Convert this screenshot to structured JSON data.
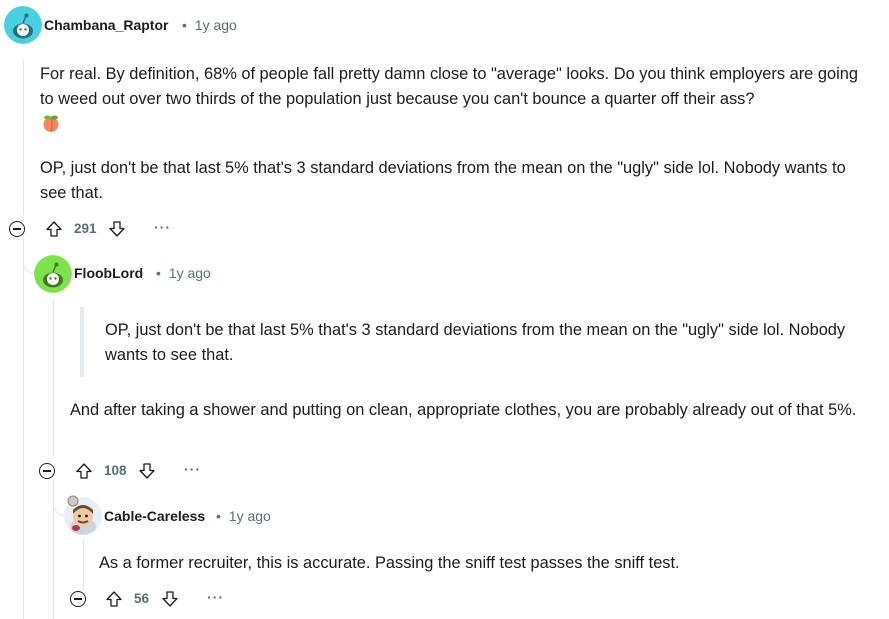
{
  "comments": [
    {
      "username": "Chambana_Raptor",
      "separator": "•",
      "time": "1y ago",
      "paragraphs": [
        "For real. By definition, 68% of people fall pretty damn close to \"average\" looks. Do you think employers are going to weed out over two thirds of the population just because you can't bounce a quarter off their ass?",
        "OP, just don't be that last 5% that's 3 standard deviations from the mean on the \"ugly\" side lol. Nobody wants to see that."
      ],
      "emoji": "peach-emoji",
      "score": "291",
      "more": "···",
      "avatar_color": "#46d1e0"
    },
    {
      "username": "FloobLord",
      "separator": "•",
      "time": "1y ago",
      "quote": "OP, just don't be that last 5% that's 3 standard deviations from the mean on the \"ugly\" side lol. Nobody wants to see that.",
      "paragraphs": [
        "And after taking a shower and putting on clean, appropriate clothes, you are probably already out of that 5%."
      ],
      "score": "108",
      "more": "···",
      "avatar_color": "#7ee34b"
    },
    {
      "username": "Cable-Careless",
      "separator": "•",
      "time": "1y ago",
      "paragraphs": [
        "As a former recruiter, this is accurate. Passing the sniff test passes the sniff test."
      ],
      "score": "56",
      "more": "···",
      "avatar_color": "#e8eef2"
    }
  ]
}
